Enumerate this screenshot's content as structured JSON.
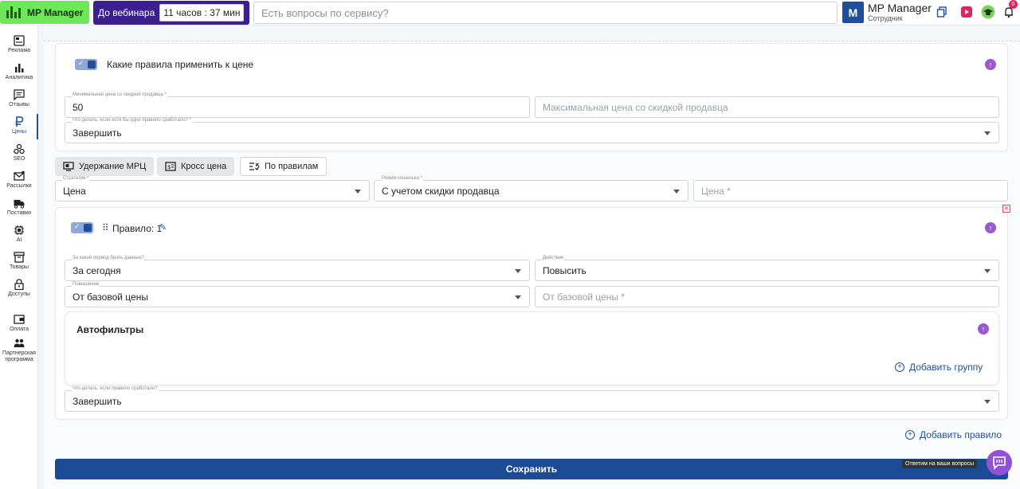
{
  "header": {
    "logo_text": "MP Manager",
    "webinar_label": "До вебинара",
    "webinar_timer": "11 часов : 37 мин",
    "search_placeholder": "Есть вопросы по сервису?",
    "user_initial": "M",
    "user_name": "MP Manager",
    "user_role": "Сотрудник",
    "notification_count": "0"
  },
  "sidebar": {
    "items": [
      {
        "label": "Реклама",
        "icon": "ad-icon"
      },
      {
        "label": "Аналитика",
        "icon": "bar-chart-icon"
      },
      {
        "label": "Отзывы",
        "icon": "comment-icon"
      },
      {
        "label": "Цены",
        "icon": "ruble-icon"
      },
      {
        "label": "SEO",
        "icon": "seo-icon"
      },
      {
        "label": "Рассылки",
        "icon": "mail-icon"
      },
      {
        "label": "Поставки",
        "icon": "truck-icon"
      },
      {
        "label": "AI",
        "icon": "chip-icon"
      },
      {
        "label": "Товары",
        "icon": "box-icon"
      },
      {
        "label": "Доступы",
        "icon": "lock-icon"
      },
      {
        "label": "Оплата",
        "icon": "wallet-icon"
      },
      {
        "label": "Партнерская программа",
        "icon": "partners-icon"
      }
    ],
    "active": "Цены"
  },
  "rules_card": {
    "title": "Какие правила применить к цене",
    "min_price_label": "Минимальная цена со скидкой продавца *",
    "min_price_value": "50",
    "max_price_placeholder": "Максимальная цена со скидкой продавца",
    "fallback_label": "Что делать, если хотя бы одно правило сработало? *",
    "fallback_value": "Завершить"
  },
  "tabs": [
    {
      "label": "Удержание МРЦ",
      "icon": "monitor-icon"
    },
    {
      "label": "Кросс цена",
      "icon": "price-tag-icon"
    },
    {
      "label": "По правилам",
      "icon": "rules-icon"
    }
  ],
  "strategy": {
    "strategy_label": "Стратегия *",
    "strategy_value": "Цена",
    "mode_label": "Режим кошелька *",
    "mode_value": "С учетом скидки продавца",
    "price_placeholder": "Цена *"
  },
  "rule": {
    "title": "Правило: 1",
    "period_label": "За какой период брать данные?",
    "period_value": "За сегодня",
    "action_label": "Действие",
    "action_value": "Повысить",
    "change_label": "Повышение",
    "change_value": "От базовой цены",
    "change_placeholder": "От базовой цены *",
    "autofilters_title": "Автофильтры",
    "add_group": "Добавить группу",
    "after_label": "Что делать, если правило сработало?",
    "after_value": "Завершить"
  },
  "add_rule": "Добавить правило",
  "save_label": "Сохранить",
  "chat_tooltip": "Ответим на ваши вопросы",
  "colors": {
    "brand_green": "#6ee75b",
    "webinar_purple": "#3b1f8e",
    "primary_blue": "#1c4b96",
    "accent_purple": "#9b59d0"
  }
}
